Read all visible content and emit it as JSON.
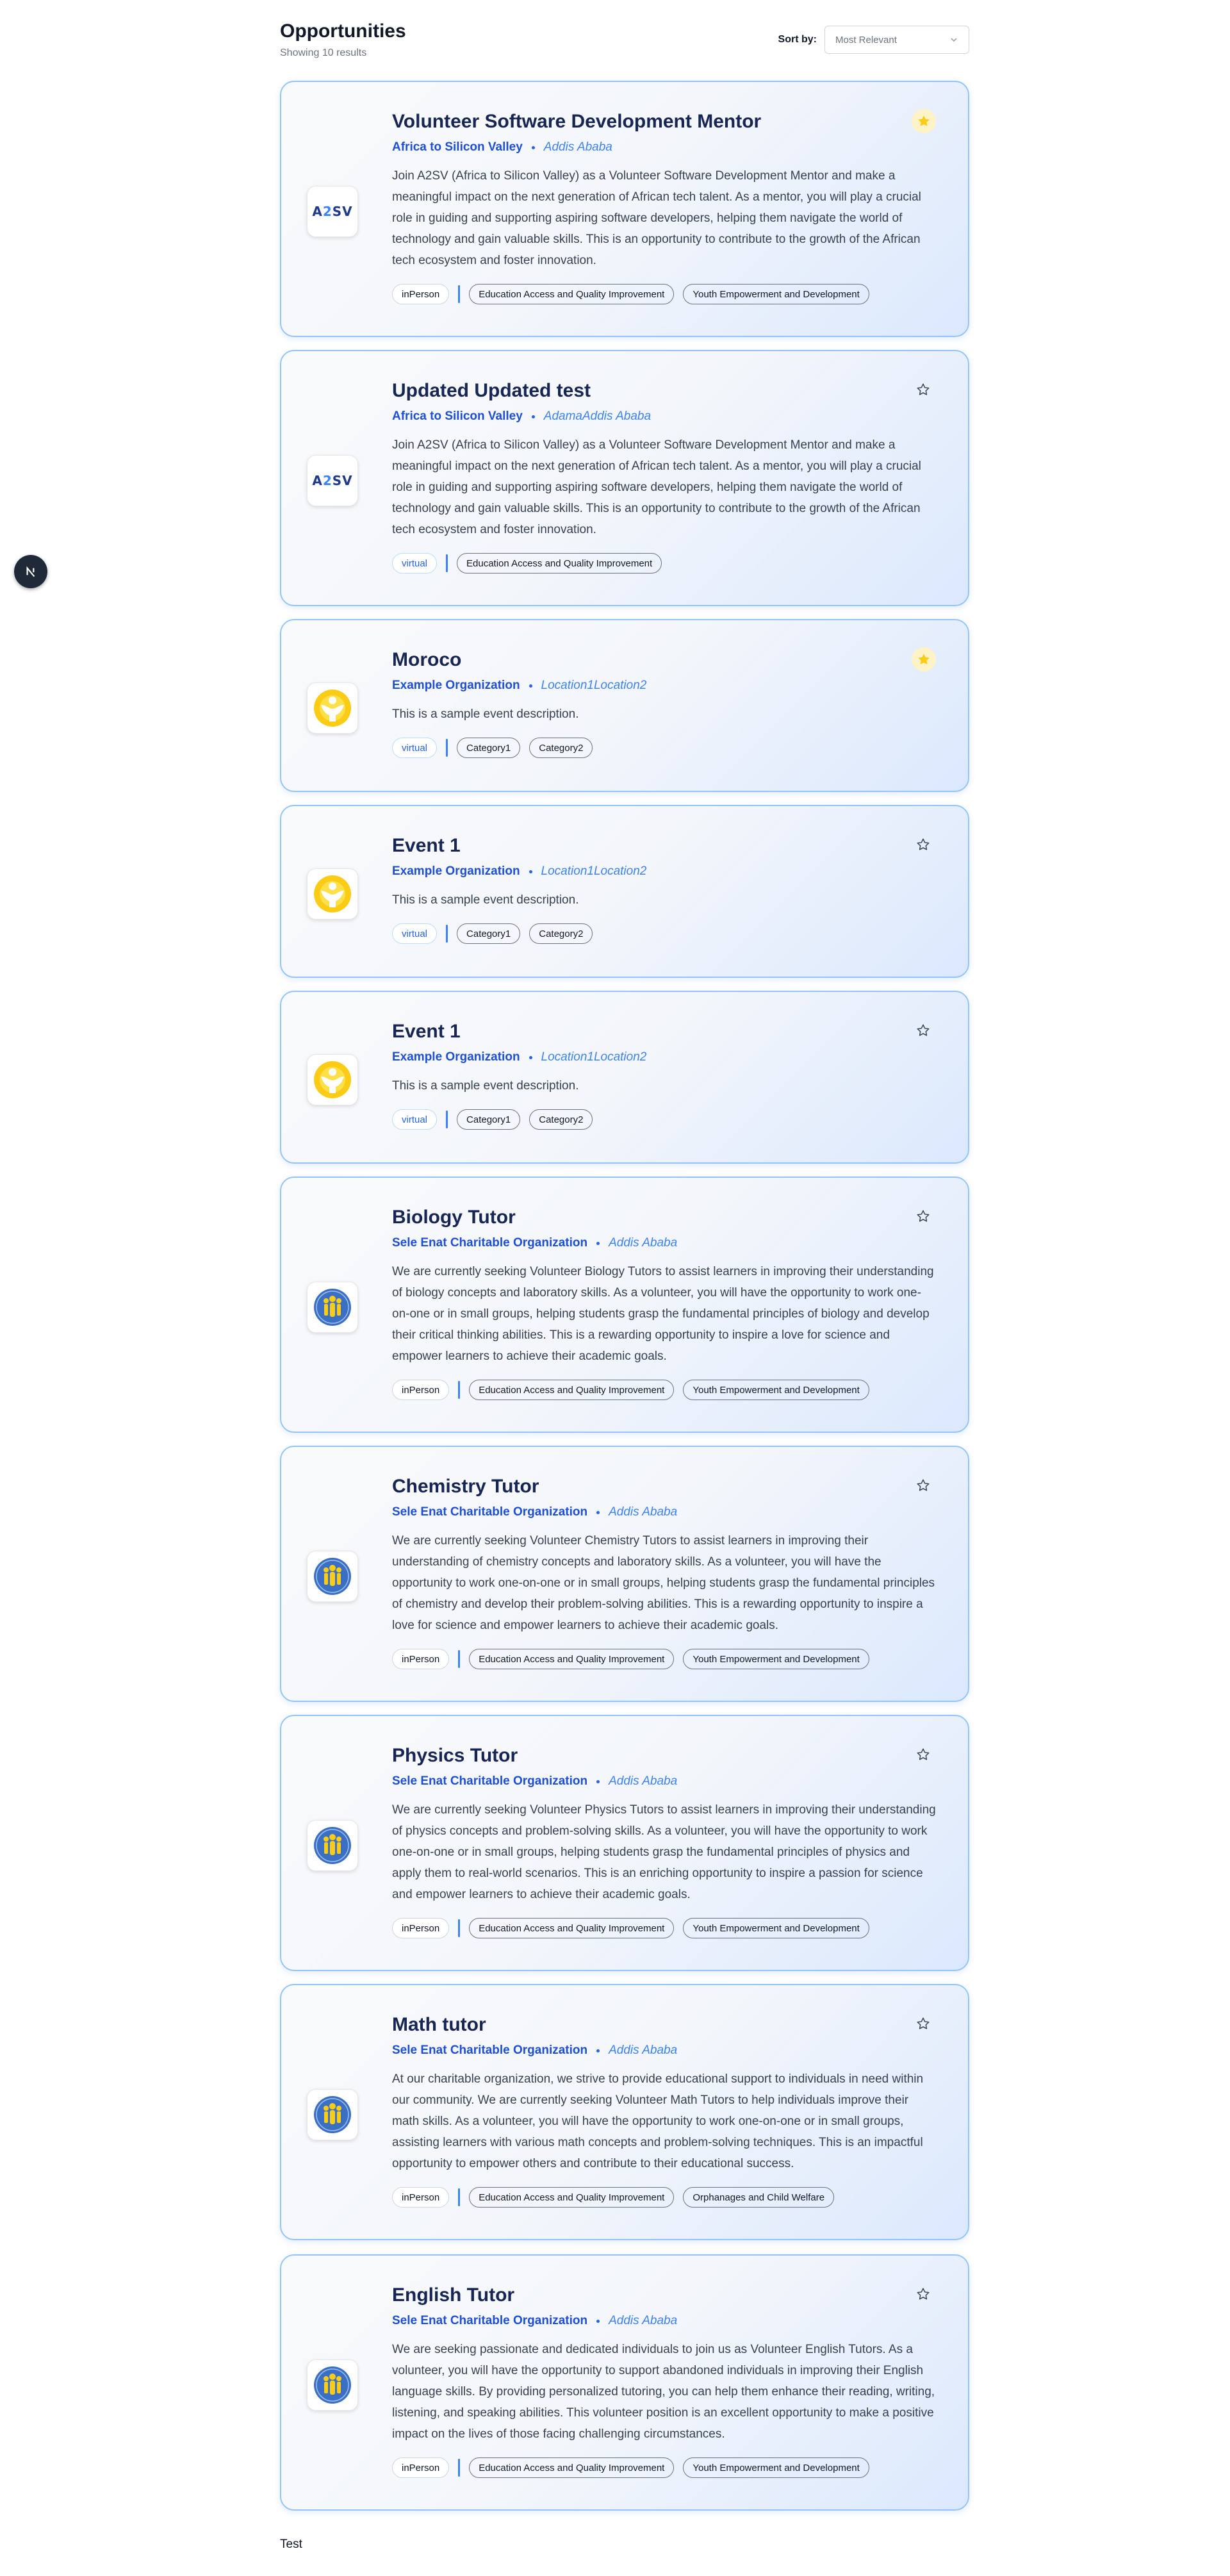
{
  "page": {
    "title": "Opportunities",
    "result_count": "Showing 10 results",
    "sort_label": "Sort by:",
    "sort_value": "Most Relevant",
    "footer_text": "Test"
  },
  "colors": {
    "accent": "#1d4ed8",
    "card_border": "#93c5fd",
    "star_active": "#facc15",
    "title": "#172554"
  },
  "cards": [
    {
      "title": "Volunteer Software Development Mentor",
      "org": "Africa to Silicon Valley",
      "location": "Addis Ababa",
      "description": "Join A2SV (Africa to Silicon Valley) as a Volunteer Software Development Mentor and make a meaningful impact on the next generation of African tech talent. As a mentor, you will play a crucial role in guiding and supporting aspiring software developers, helping them navigate the world of technology and gain valuable skills. This is an opportunity to contribute to the growth of the African tech ecosystem and foster innovation.",
      "mode": "inPerson",
      "tags": [
        "Education Access and Quality Improvement",
        "Youth Empowerment and Development"
      ],
      "logo": "a2sv-logo",
      "bookmarked": true
    },
    {
      "title": "Updated Updated test",
      "org": "Africa to Silicon Valley",
      "location": "AdamaAddis Ababa",
      "description": "Join A2SV (Africa to Silicon Valley) as a Volunteer Software Development Mentor and make a meaningful impact on the next generation of African tech talent. As a mentor, you will play a crucial role in guiding and supporting aspiring software developers, helping them navigate the world of technology and gain valuable skills. This is an opportunity to contribute to the growth of the African tech ecosystem and foster innovation.",
      "mode": "virtual",
      "tags": [
        "Education Access and Quality Improvement"
      ],
      "logo": "a2sv-logo",
      "bookmarked": false
    },
    {
      "title": "Moroco",
      "org": "Example Organization",
      "location": "Location1Location2",
      "description": "This is a sample event description.",
      "mode": "virtual",
      "tags": [
        "Category1",
        "Category2"
      ],
      "logo": "yellow-figure-logo",
      "bookmarked": true
    },
    {
      "title": "Event 1",
      "org": "Example Organization",
      "location": "Location1Location2",
      "description": "This is a sample event description.",
      "mode": "virtual",
      "tags": [
        "Category1",
        "Category2"
      ],
      "logo": "yellow-figure-logo",
      "bookmarked": false
    },
    {
      "title": "Event 1",
      "org": "Example Organization",
      "location": "Location1Location2",
      "description": "This is a sample event description.",
      "mode": "virtual",
      "tags": [
        "Category1",
        "Category2"
      ],
      "logo": "yellow-figure-logo",
      "bookmarked": false
    },
    {
      "title": "Biology Tutor",
      "org": "Sele Enat Charitable Organization",
      "location": "Addis Ababa",
      "description": "We are currently seeking Volunteer Biology Tutors to assist learners in improving their understanding of biology concepts and laboratory skills. As a volunteer, you will have the opportunity to work one-on-one or in small groups, helping students grasp the fundamental principles of biology and develop their critical thinking abilities. This is a rewarding opportunity to inspire a love for science and empower learners to achieve their academic goals.",
      "mode": "inPerson",
      "tags": [
        "Education Access and Quality Improvement",
        "Youth Empowerment and Development"
      ],
      "logo": "sele-enat-logo",
      "bookmarked": false
    },
    {
      "title": "Chemistry Tutor",
      "org": "Sele Enat Charitable Organization",
      "location": "Addis Ababa",
      "description": "We are currently seeking Volunteer Chemistry Tutors to assist learners in improving their understanding of chemistry concepts and laboratory skills. As a volunteer, you will have the opportunity to work one-on-one or in small groups, helping students grasp the fundamental principles of chemistry and develop their problem-solving abilities. This is a rewarding opportunity to inspire a love for science and empower learners to achieve their academic goals.",
      "mode": "inPerson",
      "tags": [
        "Education Access and Quality Improvement",
        "Youth Empowerment and Development"
      ],
      "logo": "sele-enat-logo",
      "bookmarked": false
    },
    {
      "title": "Physics Tutor",
      "org": "Sele Enat Charitable Organization",
      "location": "Addis Ababa",
      "description": "We are currently seeking Volunteer Physics Tutors to assist learners in improving their understanding of physics concepts and problem-solving skills. As a volunteer, you will have the opportunity to work one-on-one or in small groups, helping students grasp the fundamental principles of physics and apply them to real-world scenarios. This is an enriching opportunity to inspire a passion for science and empower learners to achieve their academic goals.",
      "mode": "inPerson",
      "tags": [
        "Education Access and Quality Improvement",
        "Youth Empowerment and Development"
      ],
      "logo": "sele-enat-logo",
      "bookmarked": false
    },
    {
      "title": "Math tutor",
      "org": "Sele Enat Charitable Organization",
      "location": "Addis Ababa",
      "description": "At our charitable organization, we strive to provide educational support to individuals in need within our community. We are currently seeking Volunteer Math Tutors to help individuals improve their math skills. As a volunteer, you will have the opportunity to work one-on-one or in small groups, assisting learners with various math concepts and problem-solving techniques. This is an impactful opportunity to empower others and contribute to their educational success.",
      "mode": "inPerson",
      "tags": [
        "Education Access and Quality Improvement",
        "Orphanages and Child Welfare"
      ],
      "logo": "sele-enat-logo",
      "bookmarked": false
    },
    {
      "title": "English Tutor",
      "org": "Sele Enat Charitable Organization",
      "location": "Addis Ababa",
      "description": "We are seeking passionate and dedicated individuals to join us as Volunteer English Tutors. As a volunteer, you will have the opportunity to support abandoned individuals in improving their English language skills. By providing personalized tutoring, you can help them enhance their reading, writing, listening, and speaking abilities. This volunteer position is an excellent opportunity to make a positive impact on the lives of those facing challenging circumstances.",
      "mode": "inPerson",
      "tags": [
        "Education Access and Quality Improvement",
        "Youth Empowerment and Development"
      ],
      "logo": "sele-enat-logo",
      "bookmarked": false
    }
  ]
}
